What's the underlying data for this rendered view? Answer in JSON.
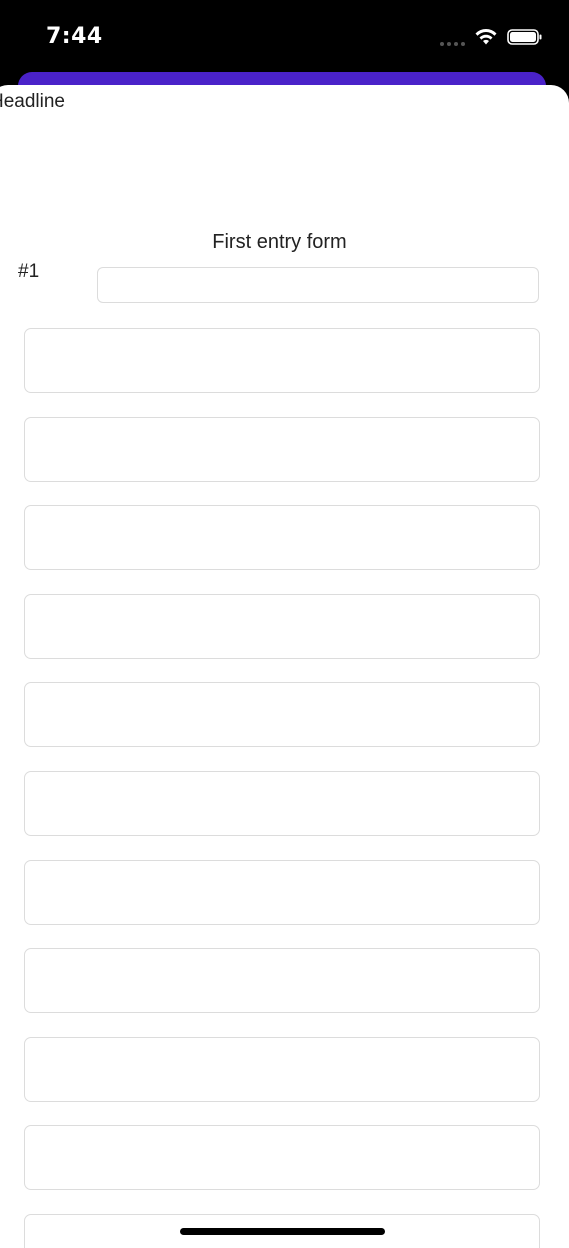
{
  "status_bar": {
    "time": "7:44"
  },
  "colors": {
    "status_bar_bg": "#000000",
    "sheet_accent": "#4a22c9",
    "card_bg": "#ffffff",
    "field_border": "#dcdcdc"
  },
  "icons": {
    "signal": "signal-dots-icon",
    "wifi": "wifi-icon",
    "battery": "battery-icon"
  },
  "card": {
    "headline": "Headline",
    "form_title": "First entry form",
    "entry_label": "#1",
    "entry_input_value": "",
    "fields": [
      "",
      "",
      "",
      "",
      "",
      "",
      "",
      "",
      "",
      "",
      ""
    ]
  }
}
